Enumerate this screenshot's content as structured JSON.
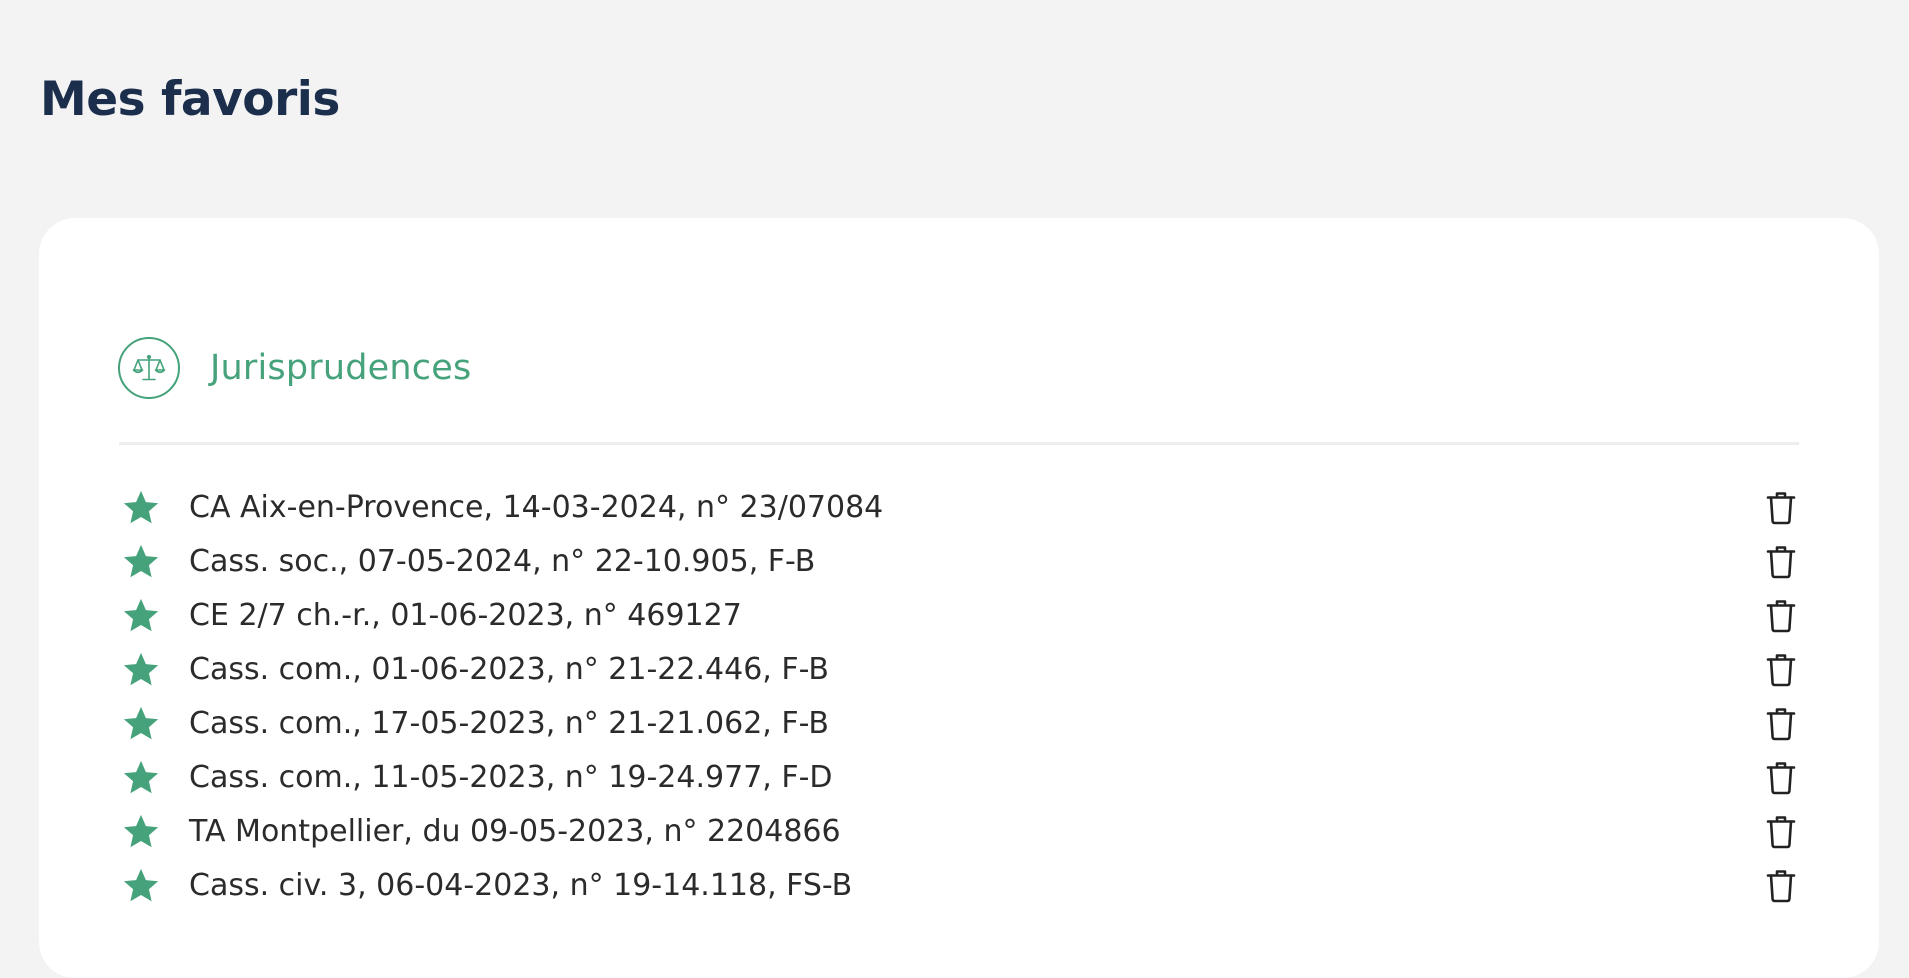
{
  "page": {
    "title": "Mes favoris"
  },
  "section": {
    "title": "Jurisprudences",
    "icon": "scales-icon"
  },
  "favorites": [
    {
      "label": "CA Aix-en-Provence, 14-03-2024, n° 23/07084"
    },
    {
      "label": "Cass. soc., 07-05-2024, n° 22-10.905, F-B"
    },
    {
      "label": "CE 2/7 ch.-r., 01-06-2023, n° 469127"
    },
    {
      "label": "Cass. com., 01-06-2023, n° 21-22.446, F-B"
    },
    {
      "label": "Cass. com., 17-05-2023, n° 21-21.062, F-B"
    },
    {
      "label": "Cass. com., 11-05-2023, n° 19-24.977, F-D"
    },
    {
      "label": "TA Montpellier, du 09-05-2023, n° 2204866"
    },
    {
      "label": "Cass. civ. 3, 06-04-2023, n° 19-14.118, FS-B"
    }
  ],
  "icons": {
    "favorite": "star-icon",
    "remove": "trash-icon"
  },
  "colors": {
    "accent": "#45a27a",
    "title": "#1b2f4d",
    "background": "#f3f3f4",
    "card": "#ffffff",
    "text": "#2b2b2b"
  }
}
